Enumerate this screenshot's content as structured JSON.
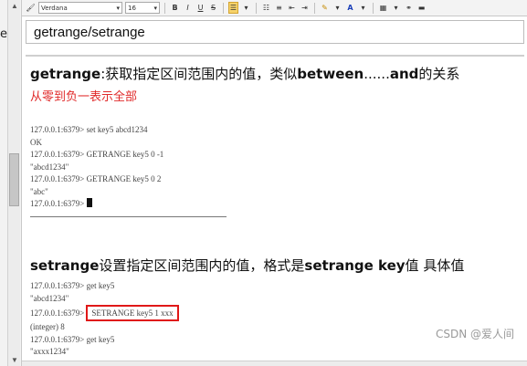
{
  "window": {
    "left_fragment": "et"
  },
  "toolbar": {
    "font_family": "Verdana",
    "font_size": "16",
    "bold": "B",
    "italic": "I",
    "underline": "U",
    "strikethrough": "S"
  },
  "document": {
    "title": "getrange/setrange",
    "getrange": {
      "keyword": "getrange",
      "desc_prefix": ":获取指定区间范围内的值，类似",
      "kw_between": "between",
      "desc_middle": "......",
      "kw_and": "and",
      "desc_suffix": "的关系",
      "note": "从零到负一表示全部",
      "terminal": [
        "127.0.0.1:6379> set key5 abcd1234",
        "OK",
        "127.0.0.1:6379> GETRANGE key5 0 -1",
        "\"abcd1234\"",
        "127.0.0.1:6379> GETRANGE key5 0 2",
        "\"abc\"",
        "127.0.0.1:6379>"
      ]
    },
    "setrange": {
      "keyword": "setrange",
      "desc_prefix": "设置指定区间范围内的值，格式是",
      "kw_syntax": "setrange key",
      "desc_suffix": "值 具体值",
      "terminal": {
        "line1": "127.0.0.1:6379> get key5",
        "line2": "\"abcd1234\"",
        "line3_prompt": "127.0.0.1:6379>",
        "line3_command": "SETRANGE key5 1 xxx",
        "line4": "(integer) 8",
        "line5": "127.0.0.1:6379> get key5",
        "line6": "\"axxx1234\""
      }
    }
  },
  "watermark": "CSDN @爱人间",
  "colors": {
    "note_red": "#e02a2a",
    "highlight_border": "#e01818",
    "toolbar_active": "#f7d36a"
  }
}
